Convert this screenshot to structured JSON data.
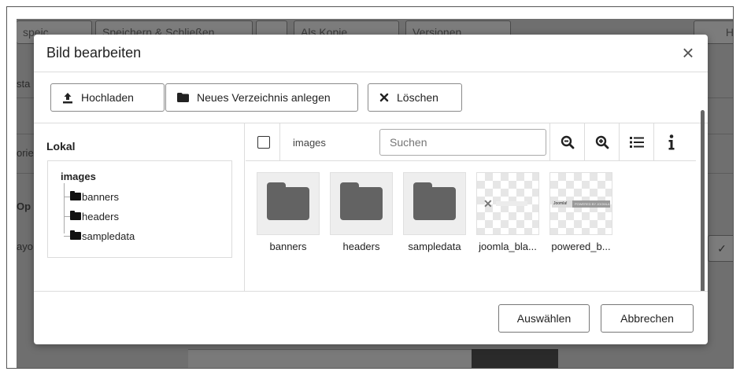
{
  "background": {
    "buttons": [
      "speic",
      "Speichern & Schließen",
      "",
      "Als Kopie",
      "Versionen",
      "H"
    ],
    "labels": [
      "sta",
      "orie",
      "Op",
      "ayo"
    ],
    "select_glyph": "✓"
  },
  "modal": {
    "title": "Bild bearbeiten",
    "close_glyph": "×",
    "toolbar": {
      "upload_label": "Hochladen",
      "new_folder_label": "Neues Verzeichnis anlegen",
      "delete_label": "Löschen"
    },
    "tree": {
      "title": "Lokal",
      "root": "images",
      "items": [
        {
          "label": "banners"
        },
        {
          "label": "headers"
        },
        {
          "label": "sampledata"
        }
      ]
    },
    "files": {
      "breadcrumb": "images",
      "search_placeholder": "Suchen",
      "items": [
        {
          "name": "banners",
          "type": "folder"
        },
        {
          "name": "headers",
          "type": "folder"
        },
        {
          "name": "sampledata",
          "type": "folder"
        },
        {
          "name": "joomla_bla...",
          "type": "image"
        },
        {
          "name": "powered_b...",
          "type": "image",
          "banner_left": "Joomla!",
          "banner_right": "POWERED BY JOOMLA!"
        }
      ]
    },
    "footer": {
      "select_label": "Auswählen",
      "cancel_label": "Abbrechen"
    }
  }
}
